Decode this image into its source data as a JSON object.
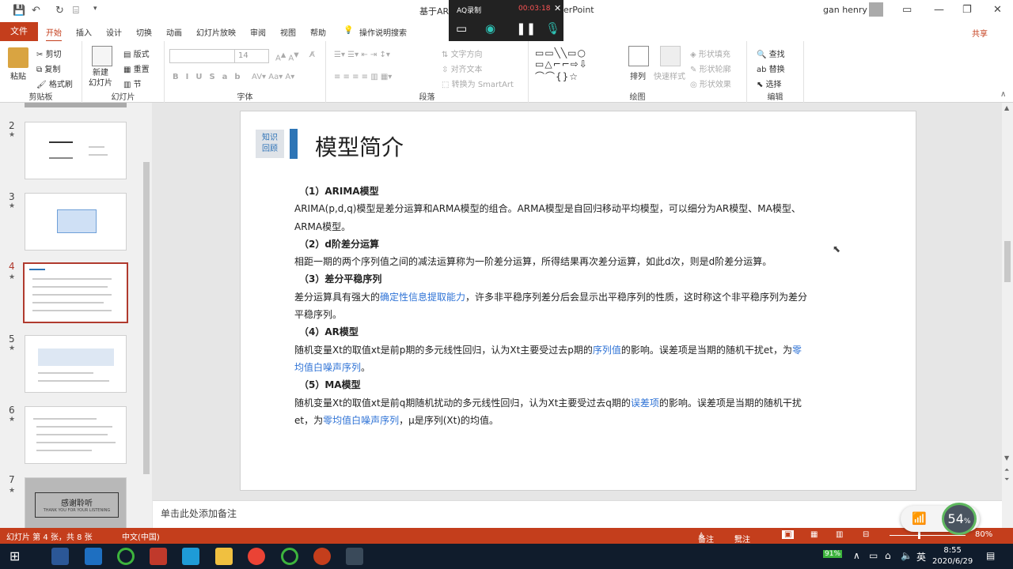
{
  "window": {
    "title_left": "基于ARI",
    "title_right": "erPoint",
    "user": "gan henry"
  },
  "recorder": {
    "name": "AQ录制",
    "time": "00:03:18"
  },
  "tabs": [
    "文件",
    "开始",
    "插入",
    "设计",
    "切换",
    "动画",
    "幻灯片放映",
    "审阅",
    "视图",
    "帮助",
    "操作说明搜索"
  ],
  "share": "共享",
  "ribbon": {
    "clipboard": {
      "paste": "粘贴",
      "cut": "剪切",
      "copy": "复制",
      "painter": "格式刷",
      "label": "剪贴板"
    },
    "slides": {
      "new": "新建\n幻灯片",
      "layout": "版式",
      "reset": "重置",
      "section": "节",
      "label": "幻灯片"
    },
    "font": {
      "size": "14",
      "label": "字体"
    },
    "paragraph": {
      "text_dir": "文字方向",
      "align": "对齐文本",
      "smartart": "转换为 SmartArt",
      "label": "段落"
    },
    "drawing": {
      "arrange": "排列",
      "quick_styles": "快速样式",
      "fill": "形状填充",
      "outline": "形状轮廓",
      "effects": "形状效果",
      "label": "绘图"
    },
    "editing": {
      "find": "查找",
      "replace": "替换",
      "select": "选择",
      "label": "编辑"
    }
  },
  "thumbnails": [
    {
      "num": "2"
    },
    {
      "num": "3"
    },
    {
      "num": "4"
    },
    {
      "num": "5"
    },
    {
      "num": "6"
    },
    {
      "num": "7",
      "text": "感谢聆听",
      "sub": "THANK YOU FOR YOUR LISTENING"
    }
  ],
  "slide": {
    "tag": [
      "知识",
      "回顾"
    ],
    "title": "模型简介",
    "sections": [
      {
        "heading": "（1）ARIMA模型",
        "text": "ARIMA(p,d,q)模型是差分运算和ARMA模型的组合。ARMA模型是自回归移动平均模型，可以细分为AR模型、MA模型、ARMA模型。"
      },
      {
        "heading": "（2）d阶差分运算",
        "text": "相距一期的两个序列值之间的减法运算称为一阶差分运算，所得结果再次差分运算，如此d次，则是d阶差分运算。"
      },
      {
        "heading": "（3）差分平稳序列",
        "t1": "差分运算具有强大的",
        "b1": "确定性信息提取能力",
        "t2": "，许多非平稳序列差分后会显示出平稳序列的性质，这时称这个非平稳序列为差分平稳序列。"
      },
      {
        "heading": "（4）AR模型",
        "t1": "随机变量Xt的取值xt是前p期的多元线性回归，认为Xt主要受过去p期的",
        "b1": "序列值",
        "t2": "的影响。误差项是当期的随机干扰et，为",
        "b2": "零均值白噪声序列",
        "t3": "。"
      },
      {
        "heading": "（5）MA模型",
        "t1": "随机变量Xt的取值xt是前q期随机扰动的多元线性回归，认为Xt主要受过去q期的",
        "b1": "误差项",
        "t2": "的影响。误差项是当期的随机干扰et，为",
        "b2": "零均值白噪声序列",
        "t3": "，μ是序列(Xt)的均值。"
      }
    ]
  },
  "notes_placeholder": "单击此处添加备注",
  "status": {
    "slide_info": "幻灯片 第 4 张，共 8 张",
    "language": "中文(中国)",
    "notes": "备注",
    "comments": "批注",
    "zoom": "80%"
  },
  "network_widget": {
    "value": "54",
    "unit": "%"
  },
  "taskbar": {
    "battery": "91%",
    "ime": "英",
    "time": "8:55",
    "date": "2020/6/29"
  }
}
